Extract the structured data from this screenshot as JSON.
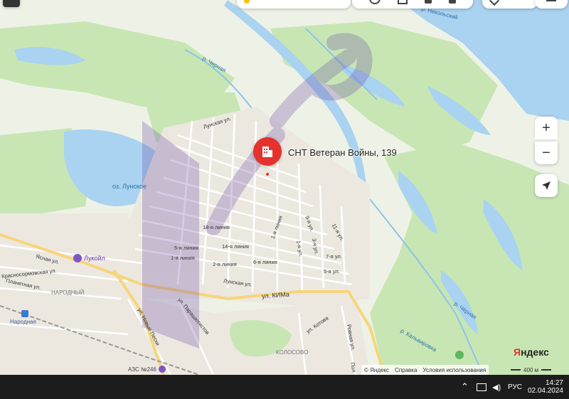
{
  "marker": {
    "label": "СНТ Ветеран Войны, 139",
    "icon": "building-icon"
  },
  "places": {
    "lake": "оз. Лунское",
    "lukoil": "Лукойл",
    "narodny": "НАРОДНЫЙ",
    "station": "Народная",
    "kolosovo": "КОЛОСОВО",
    "azs": "АЗС №246"
  },
  "rivers": {
    "nikolsky": "р. Никольский",
    "chernaya_top": "р. Черная",
    "chyornaya": "р. Чёрная",
    "kalvyrovka": "р. Кальвировка"
  },
  "streets": {
    "lunskaya_top": "Лунская ул.",
    "yasnaya": "Ясная ул.",
    "krasnosormovskaya": "Красносормовская ул.",
    "planetnaya": "Планетная ул.",
    "lunskaya": "Лунская ул.",
    "kima": "ул. КИМа",
    "novye_peski": "ул. Новые Пески",
    "parashyutistov": "ул. Парашютистов",
    "kotova": "ул. Котова",
    "rovnaya": "Ровная ул.",
    "pol": "Пол",
    "l18": "18-я линия",
    "l5": "5-я линия",
    "l14": "14-я линия",
    "l1": "1-я линия",
    "l2": "2-я линия",
    "l6": "6-я линия",
    "l1v": "1-я линия",
    "l9": "9-я ул.",
    "l11": "11-я ул.",
    "l1u": "1-я ул.",
    "l3": "3-я ул.",
    "l7": "7-я ул.",
    "l5u": "5-я ул."
  },
  "controls": {
    "zoom_in": "+",
    "zoom_out": "−"
  },
  "brand": "Яндекс",
  "footer": {
    "copyright": "© Яндекс",
    "help": "Справка",
    "terms": "Условия использования",
    "scale": "400 м"
  },
  "taskbar": {
    "lang": "РУС",
    "time": "14:27",
    "date": "02.04.2024"
  },
  "colors": {
    "water": "#a9d3f0",
    "forest": "#c8e6b4",
    "road": "#ffffff",
    "main_road": "#f7d57b",
    "marker": "#e5322d",
    "watermark": "#6a4aa8"
  }
}
